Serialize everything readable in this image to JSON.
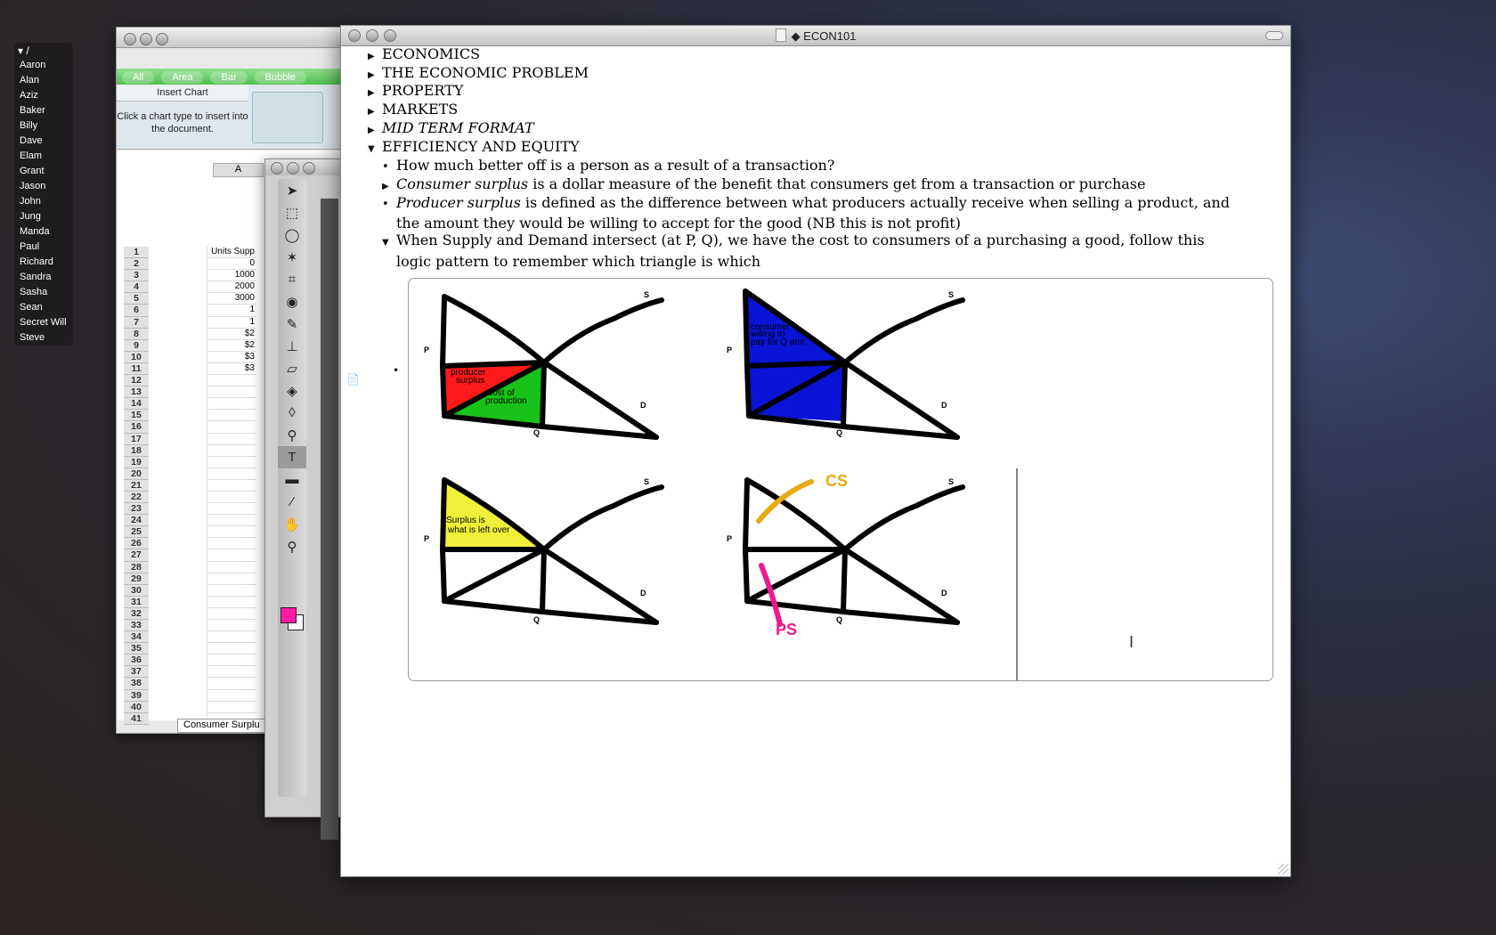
{
  "name_list": {
    "header": "/",
    "items": [
      "Aaron",
      "Alan",
      "Aziz",
      "Baker",
      "Billy",
      "Dave",
      "Elam",
      "Grant",
      "Jason",
      "John",
      "Jung",
      "Manda",
      "Paul",
      "Richard",
      "Sandra",
      "Sasha",
      "Sean",
      "Secret Will",
      "Steve"
    ]
  },
  "spreadsheet": {
    "gallery_tabs": [
      "All",
      "Area",
      "Bar",
      "Bubble"
    ],
    "insert_chart_title": "Insert Chart",
    "insert_chart_desc": "Click a chart type to insert into the document.",
    "column_header": "A",
    "row_numbers": [
      "1",
      "2",
      "3",
      "4",
      "5",
      "6",
      "7",
      "8",
      "9",
      "10",
      "11",
      "12",
      "13",
      "14",
      "15",
      "16",
      "17",
      "18",
      "19",
      "20",
      "21",
      "22",
      "23",
      "24",
      "25",
      "26",
      "27",
      "28",
      "29",
      "30",
      "31",
      "32",
      "33",
      "34",
      "35",
      "36",
      "37",
      "38",
      "39",
      "40",
      "41"
    ],
    "cells": [
      "Units Supp",
      "0",
      "1000",
      "2000",
      "3000",
      "1",
      "1",
      "$2",
      "$2",
      "$3",
      "$3"
    ],
    "sheet_tab": "Consumer Surplu"
  },
  "paint": {
    "tools": [
      "arrow-icon",
      "marquee-icon",
      "lasso-icon",
      "magic-wand-icon",
      "crop-icon",
      "eye-icon",
      "brush-icon",
      "stamp-icon",
      "eraser-icon",
      "bucket-icon",
      "drop-icon",
      "bulb-icon",
      "text-icon",
      "rectangle-icon",
      "eyedropper-icon",
      "hand-icon",
      "zoom-icon"
    ],
    "selected_tool": "text-icon",
    "foreground_color": "#ff1aa6"
  },
  "document": {
    "title": "ECON101",
    "outline": [
      {
        "text": "ECONOMICS"
      },
      {
        "text": "THE ECONOMIC PROBLEM"
      },
      {
        "text": "PROPERTY"
      },
      {
        "text": "MARKETS"
      },
      {
        "text": "MID TERM FORMAT"
      },
      {
        "text": "EFFICIENCY AND EQUITY"
      }
    ],
    "sub": {
      "s1": "How much better off is a person as a result of a transaction?",
      "s2_em": "Consumer surplus",
      "s2_rest": " is a dollar measure of the benefit that consumers get from a transaction or purchase",
      "s3_em": "Producer surplus",
      "s3_rest": " is defined as the difference between what producers actually receive when selling a product, and the amount they would be willing to accept for the good (NB this is not profit)",
      "s4": "When Supply and Demand intersect (at P, Q), we have the cost to consumers of a purchasing a good, follow this logic pattern to remember which triangle is which"
    },
    "diagrams": {
      "S": "S",
      "D": "D",
      "P": "P",
      "Q": "Q",
      "d1_label_a": "producer",
      "d1_label_b": "surplus",
      "d1_label_c": "Cost of",
      "d1_label_d": "production",
      "d2_label_a": "consumer",
      "d2_label_b": "willing to",
      "d2_label_c": "pay for Q amt",
      "d3_label_a": "Surplus is",
      "d3_label_b": "what is left over",
      "d4_cs": "CS",
      "d4_ps": "PS",
      "colors": {
        "red": "#ff1a1a",
        "green": "#19c219",
        "blue": "#0a14d6",
        "yellow": "#f0f03a",
        "orange": "#e8aa12",
        "pink": "#ec1a8c"
      }
    }
  }
}
